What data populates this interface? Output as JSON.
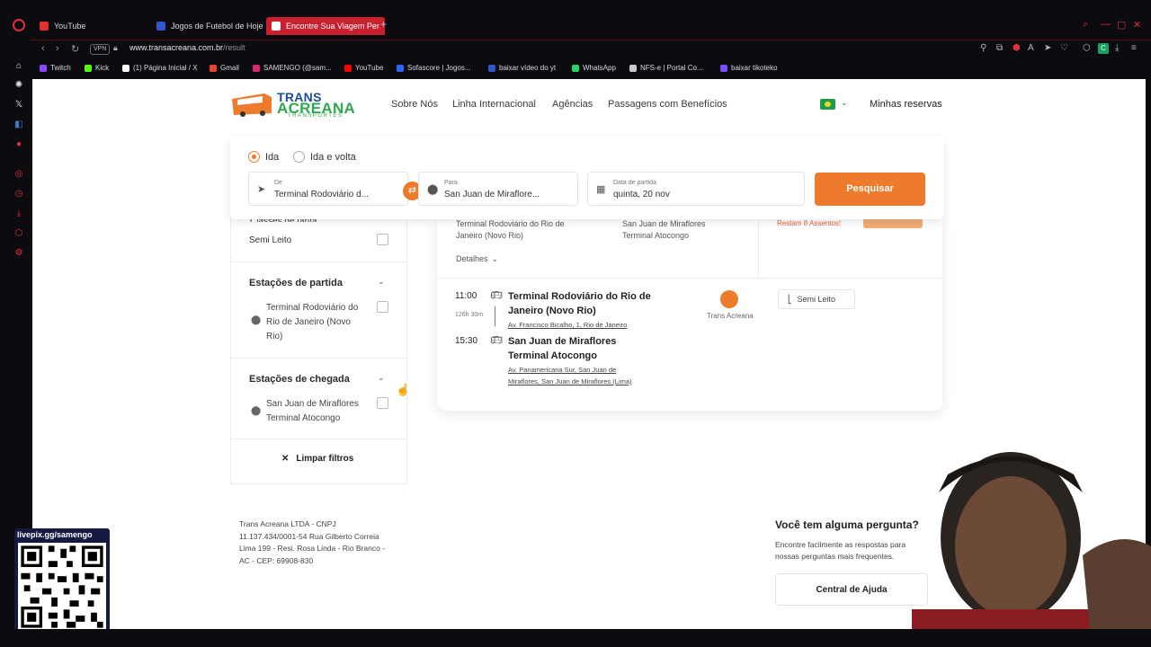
{
  "browser": {
    "tabs": [
      {
        "label": "YouTube",
        "color": "#e03030"
      },
      {
        "label": "Jogos de Futebol de Hoje",
        "color": "#3355cc"
      },
      {
        "label": "Encontre Sua Viagem Per",
        "color": "#ee7a2c",
        "active": true
      }
    ],
    "vpn": "VPN",
    "url_domain": "www.transacreana.com.br",
    "url_path": "/result",
    "bookmarks": [
      {
        "label": "Twitch",
        "color": "#9146ff"
      },
      {
        "label": "Kick",
        "color": "#53fc18"
      },
      {
        "label": "(1) Página Inicial / X",
        "color": "#ffffff"
      },
      {
        "label": "Gmail",
        "color": "#ea4335"
      },
      {
        "label": "SAMENGO (@sam...",
        "color": "#d62976"
      },
      {
        "label": "YouTube",
        "color": "#ff0000"
      },
      {
        "label": "Sofascore | Jogos...",
        "color": "#2c64f6"
      },
      {
        "label": "baixar vídeo do yt",
        "color": "#3355cc"
      },
      {
        "label": "WhatsApp",
        "color": "#25d366"
      },
      {
        "label": "NFS-e | Portal Co...",
        "color": "#cccccc"
      },
      {
        "label": "baixar tikoteko",
        "color": "#7b4cff"
      }
    ]
  },
  "site": {
    "logo": {
      "line1": "TRANS",
      "line2": "ACREANA",
      "line3": "TRANSPORTES"
    },
    "nav": [
      "Sobre Nós",
      "Linha Internacional",
      "Agências",
      "Passagens com Benefícios"
    ],
    "reservations": "Minhas reservas"
  },
  "search": {
    "trip_one_way": "Ida",
    "trip_round": "Ida e volta",
    "from_label": "De",
    "from_value": "Terminal Rodoviário d...",
    "to_label": "Para",
    "to_value": "San Juan de Miraflore...",
    "date_label": "Data de partida",
    "date_value": "quinta, 20 nov",
    "button": "Pesquisar"
  },
  "filters": {
    "cut_heading": "Classes de tarifa",
    "class_option": "Semi Leito",
    "departure_title": "Estações de partida",
    "departure_station": [
      "Terminal Rodoviário do",
      "Rio de Janeiro (Novo",
      "Rio)"
    ],
    "arrival_title": "Estações de chegada",
    "arrival_station": [
      "San Juan de Miraflores",
      "Terminal Atocongo"
    ],
    "clear": "Limpar filtros"
  },
  "result": {
    "top_origin": [
      "Terminal Rodoviário do Rio de",
      "Janeiro (Novo Rio)"
    ],
    "top_dest": [
      "San Juan de Miraflores",
      "Terminal Atocongo"
    ],
    "seats_left": "Restam 8 Assentos!",
    "details": "Detalhes",
    "depart_time": "11:00",
    "duration": "126h 30m",
    "arrive_time": "15:30",
    "origin_name": [
      "Terminal Rodoviário do Rio de",
      "Janeiro (Novo Rio)"
    ],
    "origin_addr": "Av. Francisco Bicalho, 1, Rio de Janeiro",
    "dest_name": [
      "San Juan de Miraflores",
      "Terminal Atocongo"
    ],
    "dest_addr": [
      "Av. Panamericana Sur, San Juan de",
      "Miraflores, San Juan de Miraflores (Lima)"
    ],
    "operator": "Trans Acreana",
    "seat_class": "Semi Leito"
  },
  "footer": {
    "company": [
      "Trans Acreana LTDA - CNPJ",
      "11.137.434/0001-54 Rua Gilberto Correia",
      "Lima 199 - Resi. Rosa Linda - Rio Branco -",
      "AC - CEP: 69908-830"
    ],
    "faq_title": "Você tem alguma pergunta?",
    "faq_text": [
      "Encontre facilmente as respostas para",
      "nossas perguntas mais frequentes."
    ],
    "help_button": "Central de Ajuda"
  },
  "overlay": {
    "qr_label": "livepix.gg/samengo"
  },
  "colors": {
    "accent": "#ee7a2c",
    "brand_blue": "#1a4d96",
    "brand_green": "#2fa84f"
  }
}
